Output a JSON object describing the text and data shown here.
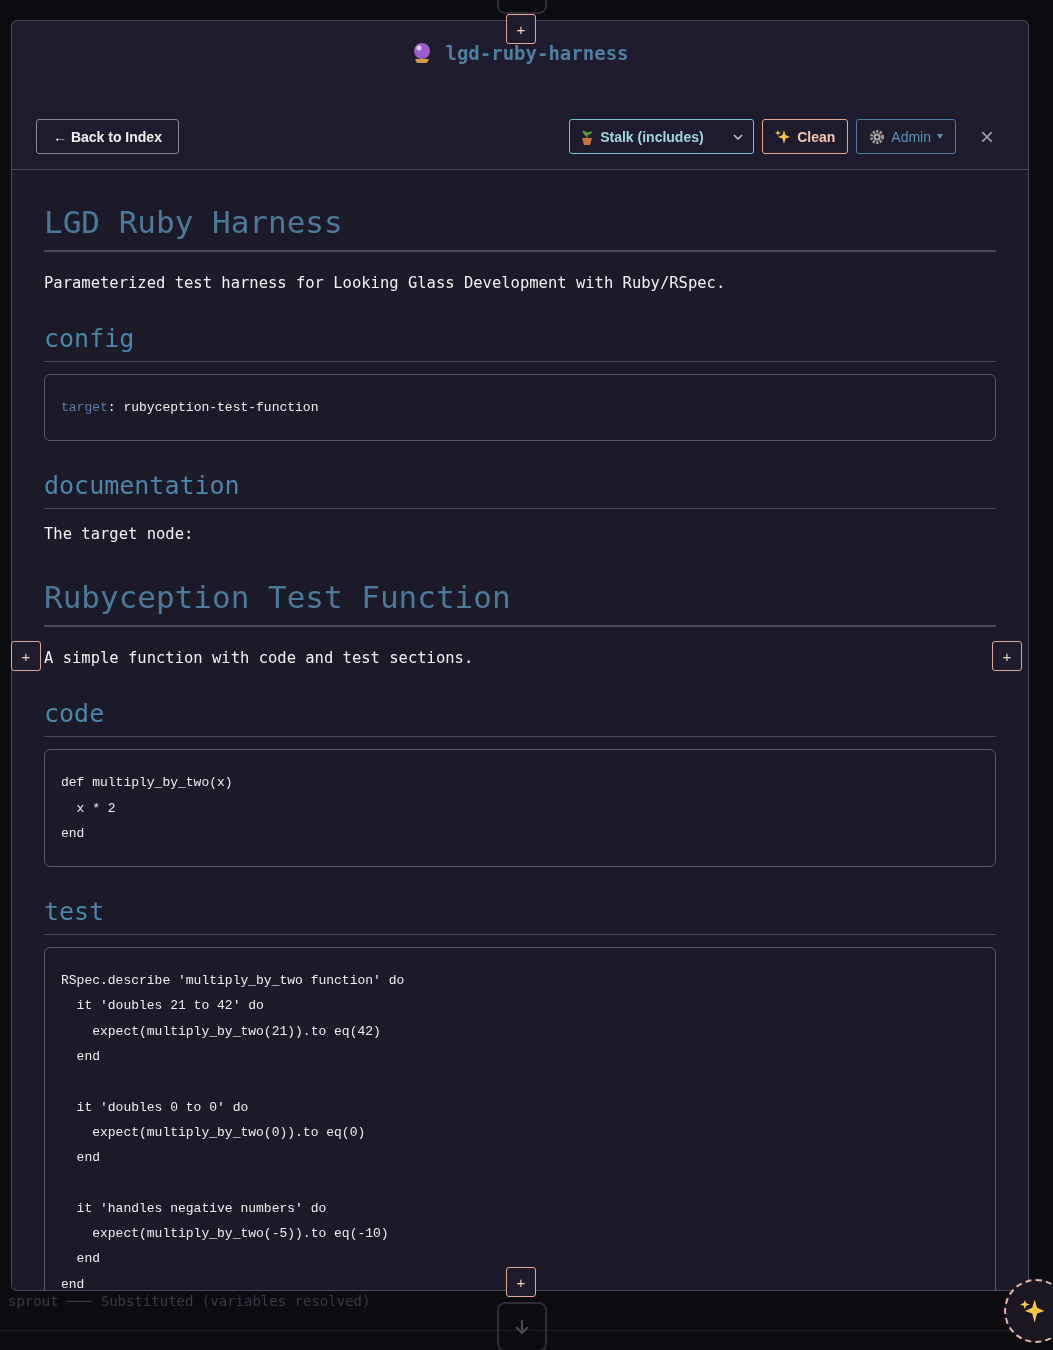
{
  "background": {
    "status_line": "sprout ─── Substituted (variables resolved)"
  },
  "modal": {
    "title": "lgd-ruby-harness",
    "back_button": "← Back to Index",
    "mode_select": {
      "value": "Stalk (includes)"
    },
    "clean_button": "Clean",
    "admin_button": "Admin",
    "close": "×",
    "content": [
      {
        "kind": "h1",
        "text": "LGD Ruby Harness"
      },
      {
        "kind": "p",
        "text": "Parameterized test harness for Looking Glass Development with Ruby/RSpec."
      },
      {
        "kind": "h2",
        "text": "config"
      },
      {
        "kind": "config",
        "key": "target",
        "separator": ":",
        "value": "rubyception-test-function"
      },
      {
        "kind": "h2",
        "text": "documentation"
      },
      {
        "kind": "p",
        "text": "The target node:"
      },
      {
        "kind": "h1",
        "text": "Rubyception Test Function"
      },
      {
        "kind": "p",
        "text": "A simple function with code and test sections."
      },
      {
        "kind": "h2",
        "text": "code"
      },
      {
        "kind": "code",
        "groups": [
          [
            "def multiply_by_two(x)",
            "  x * 2",
            "end"
          ]
        ]
      },
      {
        "kind": "h2",
        "text": "test"
      },
      {
        "kind": "code",
        "groups": [
          [
            "RSpec.describe 'multiply_by_two function' do",
            "  it 'doubles 21 to 42' do",
            "    expect(multiply_by_two(21)).to eq(42)",
            "  end"
          ],
          [
            "  it 'doubles 0 to 0' do",
            "    expect(multiply_by_two(0)).to eq(0)",
            "  end"
          ],
          [
            "  it 'handles negative numbers' do",
            "    expect(multiply_by_two(-5)).to eq(-10)",
            "  end",
            "end"
          ]
        ]
      }
    ]
  },
  "insert_buttons": [
    "+",
    "+",
    "+",
    "+"
  ]
}
